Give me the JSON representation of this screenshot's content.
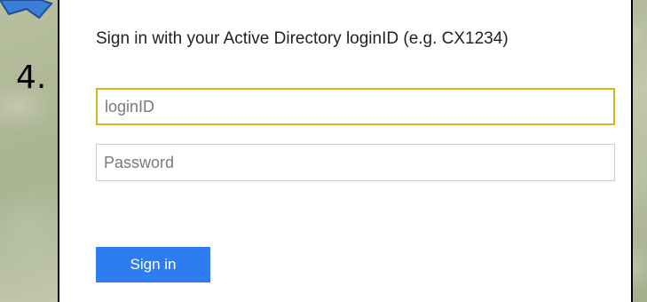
{
  "step": {
    "number": "4."
  },
  "form": {
    "prompt": "Sign in with your Active Directory loginID (e.g. CX1234)",
    "login": {
      "placeholder": "loginID",
      "value": ""
    },
    "password": {
      "placeholder": "Password",
      "value": ""
    },
    "submit_label": "Sign in"
  },
  "colors": {
    "accent": "#2d7df0",
    "focus_border": "#d8b21a"
  },
  "icons": {
    "pointer": "arrow-icon"
  }
}
